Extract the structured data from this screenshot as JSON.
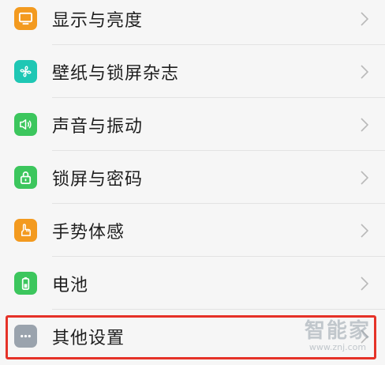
{
  "settings": {
    "items": [
      {
        "label": "显示与亮度",
        "icon": "display-icon",
        "color": "#f39a1f"
      },
      {
        "label": "壁纸与锁屏杂志",
        "icon": "pinwheel-icon",
        "color": "#1fc7b4"
      },
      {
        "label": "声音与振动",
        "icon": "speaker-icon",
        "color": "#3cc65d"
      },
      {
        "label": "锁屏与密码",
        "icon": "lock-icon",
        "color": "#3cc65d"
      },
      {
        "label": "手势体感",
        "icon": "hand-icon",
        "color": "#f39a1f"
      },
      {
        "label": "电池",
        "icon": "battery-icon",
        "color": "#3cc65d"
      },
      {
        "label": "其他设置",
        "icon": "more-icon",
        "color": "#9aa3ad"
      }
    ]
  },
  "highlight_color": "#e53228",
  "watermark": {
    "main": "智能家",
    "sub": "www.znj.com"
  }
}
